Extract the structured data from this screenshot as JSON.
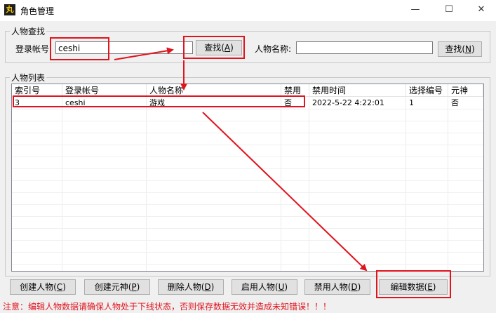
{
  "window": {
    "title": "角色管理",
    "icon_text": "丸",
    "minimize": "—",
    "maximize": "☐",
    "close": "✕"
  },
  "search": {
    "group_label": "人物查找",
    "account_label": "登录帐号",
    "account_value": "ceshi",
    "find_button": {
      "text": "查找(",
      "key": "A",
      "end": ")"
    },
    "name_label": "人物名称:",
    "name_value": "",
    "find_name_button": {
      "text": "查找(",
      "key": "N",
      "end": ")"
    }
  },
  "list": {
    "group_label": "人物列表",
    "columns": [
      "索引号",
      "登录帐号",
      "人物名称",
      "禁用",
      "禁用时间",
      "选择编号",
      "元神"
    ],
    "rows": [
      [
        "3",
        "ceshi",
        "游戏",
        "否",
        "2022-5-22 4:22:01",
        "1",
        "否"
      ]
    ]
  },
  "buttons": [
    {
      "text": "创建人物(",
      "key": "C",
      "end": ")"
    },
    {
      "text": "创建元神(",
      "key": "P",
      "end": ")"
    },
    {
      "text": "删除人物(",
      "key": "D",
      "end": ")"
    },
    {
      "text": "启用人物(",
      "key": "U",
      "end": ")"
    },
    {
      "text": "禁用人物(",
      "key": "D",
      "end": ")"
    },
    {
      "text": "编辑数据(",
      "key": "E",
      "end": ")"
    }
  ],
  "note": "注意：编辑人物数据请确保人物处于下线状态，否则保存数据无效并造成未知错误！！！",
  "colors": {
    "annotation_red": "#e0141e"
  }
}
